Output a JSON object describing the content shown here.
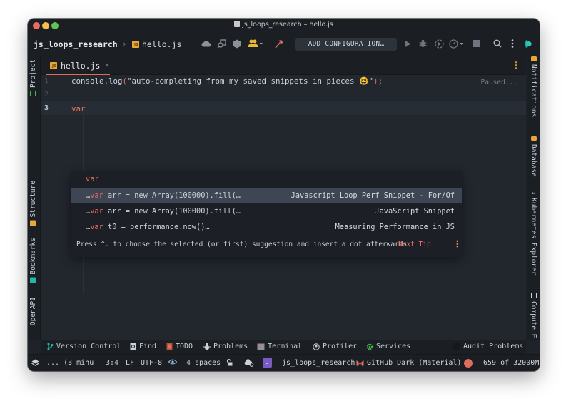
{
  "window": {
    "title": "js_loops_research – hello.js"
  },
  "navbar": {
    "project_name": "js_loops_research",
    "breadcrumb_separator": "›",
    "breadcrumb_file": "hello.js",
    "add_configuration_label": "ADD CONFIGURATION…",
    "icons": [
      "cloud-icon",
      "search-structure-icon",
      "hexagon-icon",
      "users-icon",
      "build-hammer-icon",
      "run-icon",
      "debug-icon",
      "run-with-coverage-icon",
      "profile-icon",
      "stop-icon",
      "search-icon",
      "more-icon",
      "plugin-logo-icon"
    ]
  },
  "left_stripe": {
    "tabs": [
      {
        "label": "Project",
        "icon": "project-icon"
      },
      {
        "label": "Structure",
        "icon": "structure-icon"
      },
      {
        "label": "Bookmarks",
        "icon": "bookmark-icon"
      },
      {
        "label": "OpenAPI",
        "icon": "openapi-icon"
      }
    ]
  },
  "right_stripe": {
    "tabs": [
      {
        "label": "Notifications",
        "icon": "bell-icon"
      },
      {
        "label": "Database",
        "icon": "database-icon"
      },
      {
        "label": "Kubernetes Explorer",
        "icon": "kubernetes-icon"
      },
      {
        "label": "Compute E",
        "icon": "compute-icon"
      }
    ]
  },
  "editor": {
    "tab": {
      "label": "hello.js",
      "close": "×",
      "icon_text": "JS"
    },
    "status": "Paused...",
    "lines": [
      {
        "num": "1",
        "pre": "console.log",
        "open": "(",
        "text": "\"auto-completing from my saved snippets in pieces 🤓\"",
        "close": ")",
        "end": ";"
      },
      {
        "num": "2",
        "text": ""
      },
      {
        "num": "3",
        "text": "var"
      }
    ],
    "current_line": 3
  },
  "completion": {
    "items": [
      {
        "prefix": "",
        "keyword": "var",
        "rest": "",
        "source": ""
      },
      {
        "prefix": "…",
        "keyword": "var",
        "rest": " arr = new Array(100000).fill(…",
        "source": "Javascript Loop Perf Snippet - For/Of",
        "selected": true
      },
      {
        "prefix": "…",
        "keyword": "var",
        "rest": " arr = new Array(100000).fill(…",
        "source": "JavaScript Snippet"
      },
      {
        "prefix": "…",
        "keyword": "var",
        "rest": " t0 = performance.now()…",
        "source": "Measuring Performance in JS"
      }
    ],
    "tip": "Press ^. to choose the selected (or first) suggestion and insert a dot afterwards",
    "next_tip": "Next Tip"
  },
  "tool_windows": [
    {
      "label": "Version Control",
      "icon": "git-branch-icon"
    },
    {
      "label": "Find",
      "icon": "find-icon"
    },
    {
      "label": "TODO",
      "icon": "todo-icon"
    },
    {
      "label": "Problems",
      "icon": "problems-icon"
    },
    {
      "label": "Terminal",
      "icon": "terminal-icon"
    },
    {
      "label": "Profiler",
      "icon": "profiler-icon"
    },
    {
      "label": "Services",
      "icon": "services-icon"
    },
    {
      "label": "Audit Problems",
      "icon": "audit-icon"
    }
  ],
  "statusbar": {
    "background_task": "... (3 minu",
    "position": "3:4",
    "line_ending": "LF",
    "encoding": "UTF-8",
    "indent": "4 spaces",
    "project_badge": "J",
    "project": "js_loops_research",
    "theme": "GitHub Dark (Material)",
    "memory": "659 of 32000M"
  },
  "colors": {
    "accent": "#e06c5d",
    "keyword": "#e66e5e",
    "warning": "#e8a838",
    "selection": "#3d4652",
    "editor_bg": "#22272e",
    "chrome_bg": "#1b1e23"
  }
}
